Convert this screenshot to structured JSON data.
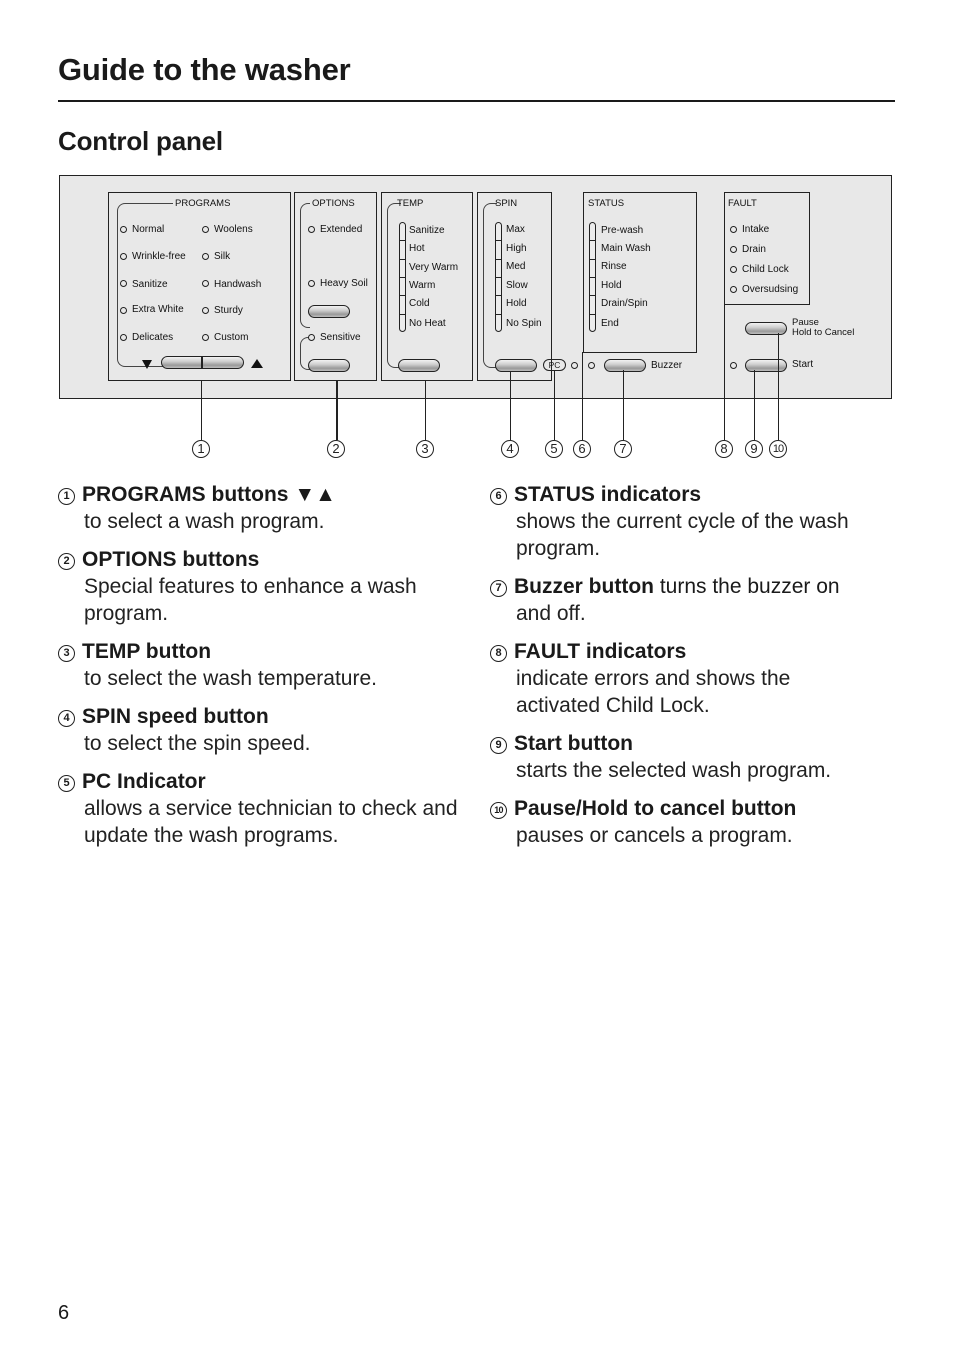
{
  "page": {
    "title": "Guide to the washer",
    "section": "Control panel",
    "page_number": "6"
  },
  "panel": {
    "programs": {
      "label": "PROGRAMS",
      "left": [
        "Normal",
        "Wrinkle-free",
        "Sanitize",
        "Extra White",
        "Delicates"
      ],
      "right": [
        "Woolens",
        "Silk",
        "Handwash",
        "Sturdy",
        "Custom"
      ],
      "down_icon": "triangle-down",
      "up_icon": "triangle-up"
    },
    "options": {
      "label": "OPTIONS",
      "items": [
        "Extended",
        "Heavy Soil",
        "Sensitive"
      ]
    },
    "temp": {
      "label": "TEMP",
      "items": [
        "Sanitize",
        "Hot",
        "Very Warm",
        "Warm",
        "Cold",
        "No Heat"
      ]
    },
    "spin": {
      "label": "SPIN",
      "items": [
        "Max",
        "High",
        "Med",
        "Slow",
        "Hold",
        "No Spin"
      ]
    },
    "pc_label": "PC",
    "status": {
      "label": "STATUS",
      "items": [
        "Pre-wash",
        "Main Wash",
        "Rinse",
        "Hold",
        "Drain/Spin",
        "End"
      ]
    },
    "buzzer_label": "Buzzer",
    "fault": {
      "label": "FAULT",
      "items": [
        "Intake",
        "Drain",
        "Child Lock",
        "Oversudsing"
      ]
    },
    "pause_label_1": "Pause",
    "pause_label_2": "Hold to Cancel",
    "start_label": "Start"
  },
  "callouts": [
    "1",
    "2",
    "3",
    "4",
    "5",
    "6",
    "7",
    "8",
    "9",
    "10"
  ],
  "descriptions": [
    {
      "num": "1",
      "title": "PROGRAMS buttons ▼▲",
      "text": "to select a wash program."
    },
    {
      "num": "2",
      "title": "OPTIONS buttons",
      "text": "Special features to enhance a wash program."
    },
    {
      "num": "3",
      "title": "TEMP button",
      "text": "to select the wash temperature."
    },
    {
      "num": "4",
      "title": "SPIN speed button",
      "text": "to select the spin speed."
    },
    {
      "num": "5",
      "title": "PC Indicator",
      "text": "allows a service technician to check and update the wash programs."
    },
    {
      "num": "6",
      "title": "STATUS indicators",
      "text": "shows the current cycle of the wash program."
    },
    {
      "num": "7",
      "title": "Buzzer button",
      "inline_text": "turns the buzzer on",
      "text": "and off."
    },
    {
      "num": "8",
      "title": "FAULT indicators",
      "text": "indicate errors and shows the activated Child Lock."
    },
    {
      "num": "9",
      "title": "Start button",
      "text": "starts the selected wash program."
    },
    {
      "num": "10",
      "title": "Pause/Hold to cancel button",
      "text": "pauses or cancels a program."
    }
  ]
}
